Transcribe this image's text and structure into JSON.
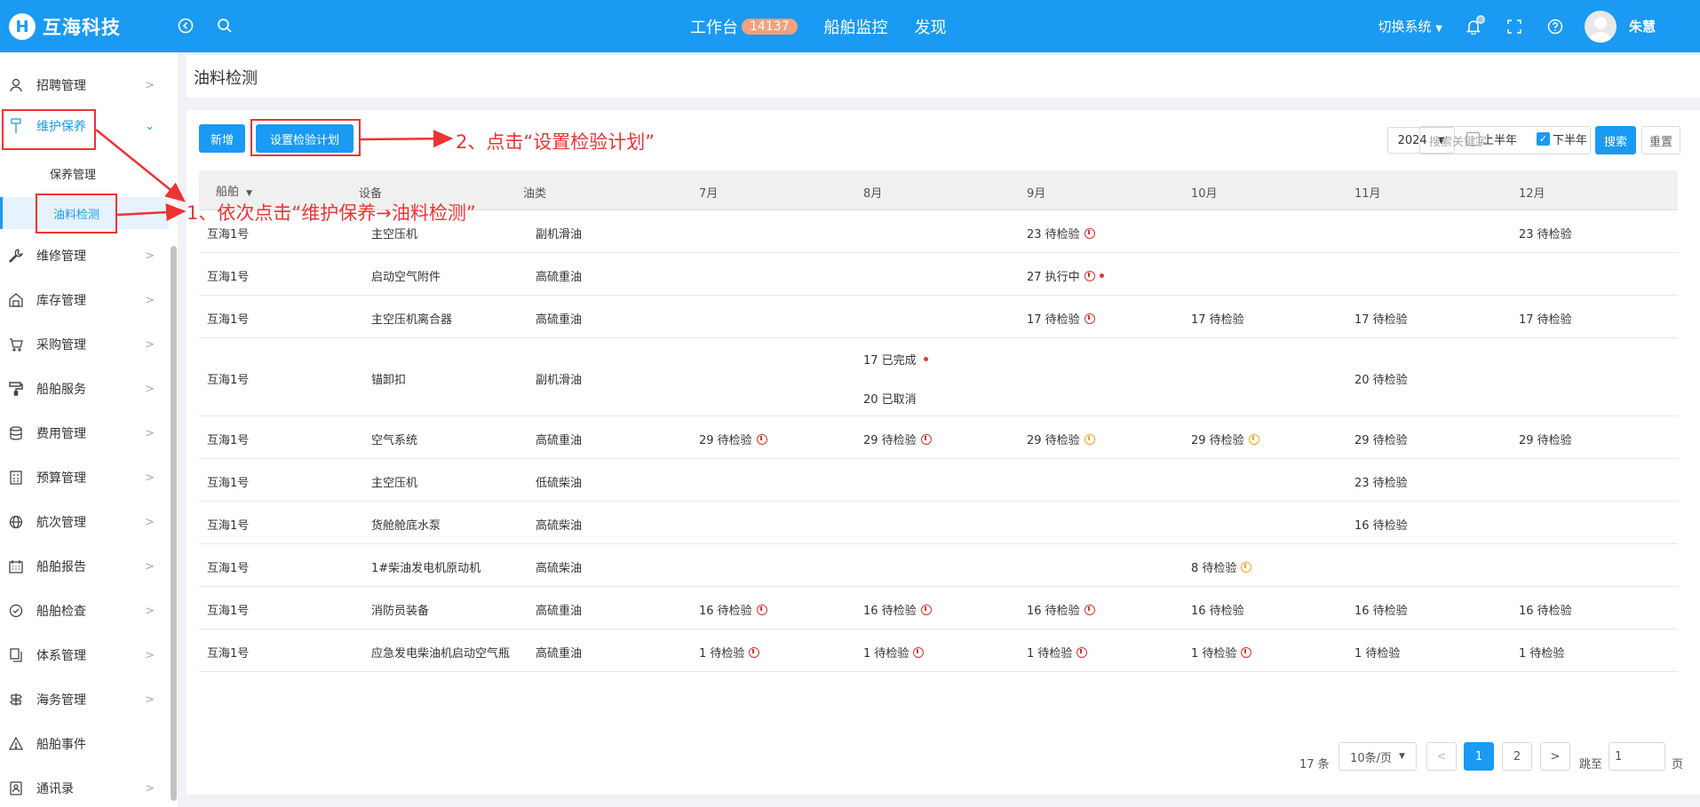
{
  "header": {
    "logo_text": "互海科技",
    "nav": [
      {
        "label": "工作台",
        "badge": "14137"
      },
      {
        "label": "船舶监控"
      },
      {
        "label": "发现"
      }
    ],
    "switch_system": "切换系统",
    "user_name": "朱慧"
  },
  "sidebar": {
    "items": [
      {
        "label": "招聘管理",
        "icon": "person-icon"
      },
      {
        "label": "维护保养",
        "icon": "brush-icon"
      },
      {
        "label": "维修管理",
        "icon": "wrench-icon"
      },
      {
        "label": "库存管理",
        "icon": "warehouse-icon"
      },
      {
        "label": "采购管理",
        "icon": "cart-icon"
      },
      {
        "label": "船舶服务",
        "icon": "paint-roller-icon"
      },
      {
        "label": "费用管理",
        "icon": "database-icon"
      },
      {
        "label": "预算管理",
        "icon": "calculator-icon"
      },
      {
        "label": "航次管理",
        "icon": "globe-icon"
      },
      {
        "label": "船舶报告",
        "icon": "calendar-icon"
      },
      {
        "label": "船舶检查",
        "icon": "check-circle-icon"
      },
      {
        "label": "体系管理",
        "icon": "documents-icon"
      },
      {
        "label": "海务管理",
        "icon": "signpost-icon"
      },
      {
        "label": "船舶事件",
        "icon": "warning-icon"
      },
      {
        "label": "通讯录",
        "icon": "contacts-icon"
      }
    ],
    "sub_items": [
      "保养管理",
      "油料检测"
    ]
  },
  "page": {
    "title": "油料检测"
  },
  "toolbar": {
    "add_label": "新增",
    "plan_label": "设置检验计划",
    "year": "2024",
    "first_half": "上半年",
    "second_half": "下半年",
    "search_placeholder": "搜索关键字",
    "search_label": "搜索",
    "reset_label": "重置"
  },
  "table": {
    "headers": [
      "船舶",
      "设备",
      "油类",
      "7月",
      "8月",
      "9月",
      "10月",
      "11月",
      "12月"
    ],
    "rows": [
      {
        "ship": "互海1号",
        "equip": "主空压机",
        "oil": "副机滑油",
        "m9": "23 待检验",
        "m12": "23 待检验"
      },
      {
        "ship": "互海1号",
        "equip": "启动空气附件",
        "oil": "高硫重油",
        "m9": "27 执行中"
      },
      {
        "ship": "互海1号",
        "equip": "主空压机离合器",
        "oil": "高硫重油",
        "m9": "17 待检验",
        "m10": "17 待检验",
        "m11": "17 待检验",
        "m12": "17 待检验"
      },
      {
        "ship": "互海1号",
        "equip": "锚卸扣",
        "oil": "副机滑油",
        "m8a": "17 已完成",
        "m8b": "20 已取消",
        "m11": "20 待检验"
      },
      {
        "ship": "互海1号",
        "equip": "空气系统",
        "oil": "高硫重油",
        "m7": "29 待检验",
        "m8": "29 待检验",
        "m9": "29 待检验",
        "m10": "29 待检验",
        "m11": "29 待检验",
        "m12": "29 待检验"
      },
      {
        "ship": "互海1号",
        "equip": "主空压机",
        "oil": "低硫柴油",
        "m11": "23 待检验"
      },
      {
        "ship": "互海1号",
        "equip": "货舱舱底水泵",
        "oil": "高硫柴油",
        "m11": "16 待检验"
      },
      {
        "ship": "互海1号",
        "equip": "1#柴油发电机原动机",
        "oil": "高硫柴油",
        "m10": "8 待检验"
      },
      {
        "ship": "互海1号",
        "equip": "消防员装备",
        "oil": "高硫重油",
        "m7": "16 待检验",
        "m8": "16 待检验",
        "m9": "16 待检验",
        "m10": "16 待检验",
        "m11": "16 待检验",
        "m12": "16 待检验"
      },
      {
        "ship": "互海1号",
        "equip": "应急发电柴油机启动空气瓶",
        "oil": "高硫重油",
        "m7": "1 待检验",
        "m8": "1 待检验",
        "m9": "1 待检验",
        "m10": "1 待检验",
        "m11": "1 待检验",
        "m12": "1 待检验"
      }
    ]
  },
  "pagination": {
    "total": "17 条",
    "page_size": "10条/页",
    "prev": "<",
    "pages": [
      "1",
      "2"
    ],
    "next": ">",
    "jump_label": "跳至",
    "jump_value": "1",
    "jump_suffix": "页"
  },
  "annotations": {
    "step1": "1、依次点击“维护保养→油料检测”",
    "step2": "2、点击“设置检验计划”"
  },
  "colors": {
    "primary": "#1a9af3",
    "annotation": "#e33333",
    "status_red": "#d9342b",
    "status_yellow": "#f0a71f"
  }
}
